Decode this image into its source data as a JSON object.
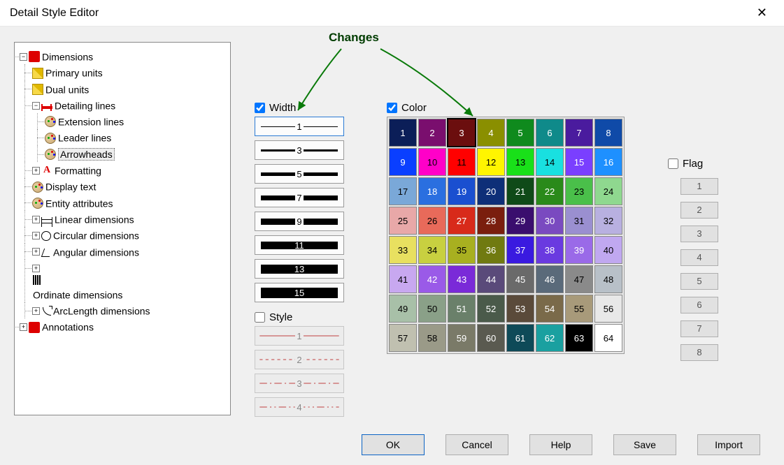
{
  "window": {
    "title": "Detail Style Editor"
  },
  "annotation": {
    "text": "Changes"
  },
  "tree": {
    "dimensions": "Dimensions",
    "primary_units": "Primary units",
    "dual_units": "Dual units",
    "detailing_lines": "Detailing lines",
    "extension_lines": "Extension lines",
    "leader_lines": "Leader lines",
    "arrowheads": "Arrowheads",
    "formatting": "Formatting",
    "display_text": "Display text",
    "entity_attributes": "Entity attributes",
    "linear_dimensions": "Linear dimensions",
    "circular_dimensions": "Circular dimensions",
    "angular_dimensions": "Angular dimensions",
    "ordinate_dimensions": "Ordinate dimensions",
    "arclength_dimensions": "ArcLength dimensions",
    "annotations": "Annotations"
  },
  "width": {
    "label": "Width",
    "checked": true,
    "selected_index": 0,
    "items": [
      {
        "value": 1,
        "thickness": 1
      },
      {
        "value": 3,
        "thickness": 3
      },
      {
        "value": 5,
        "thickness": 5
      },
      {
        "value": 7,
        "thickness": 7
      },
      {
        "value": 9,
        "thickness": 9
      },
      {
        "value": 11,
        "thickness": 11
      },
      {
        "value": 13,
        "thickness": 13
      },
      {
        "value": 15,
        "thickness": 15
      }
    ]
  },
  "style": {
    "label": "Style",
    "checked": false,
    "items": [
      {
        "value": 1,
        "dash": ""
      },
      {
        "value": 2,
        "dash": "4 4"
      },
      {
        "value": 3,
        "dash": "10 4 2 4"
      },
      {
        "value": 4,
        "dash": "10 4 2 4 2 4"
      }
    ]
  },
  "color": {
    "label": "Color",
    "checked": true,
    "selected": 3,
    "swatches": [
      {
        "n": 1,
        "bg": "#0b1e58",
        "fg": "#fff"
      },
      {
        "n": 2,
        "bg": "#7a0e6e",
        "fg": "#fff"
      },
      {
        "n": 3,
        "bg": "#6b0e0e",
        "fg": "#fff"
      },
      {
        "n": 4,
        "bg": "#8a8f00",
        "fg": "#fff"
      },
      {
        "n": 5,
        "bg": "#0f8a1d",
        "fg": "#fff"
      },
      {
        "n": 6,
        "bg": "#0f8a8a",
        "fg": "#fff"
      },
      {
        "n": 7,
        "bg": "#4a1b9e",
        "fg": "#fff"
      },
      {
        "n": 8,
        "bg": "#0f4aa8",
        "fg": "#fff"
      },
      {
        "n": 9,
        "bg": "#0a3fff",
        "fg": "#fff"
      },
      {
        "n": 10,
        "bg": "#ff00c8",
        "fg": "#000"
      },
      {
        "n": 11,
        "bg": "#ff0000",
        "fg": "#000"
      },
      {
        "n": 12,
        "bg": "#fff500",
        "fg": "#000"
      },
      {
        "n": 13,
        "bg": "#19e019",
        "fg": "#000"
      },
      {
        "n": 14,
        "bg": "#19e0e0",
        "fg": "#000"
      },
      {
        "n": 15,
        "bg": "#7a3fff",
        "fg": "#fff"
      },
      {
        "n": 16,
        "bg": "#1e90ff",
        "fg": "#fff"
      },
      {
        "n": 17,
        "bg": "#7aa8d8",
        "fg": "#000"
      },
      {
        "n": 18,
        "bg": "#2a6fe0",
        "fg": "#fff"
      },
      {
        "n": 19,
        "bg": "#1a4fd0",
        "fg": "#fff"
      },
      {
        "n": 20,
        "bg": "#0e2f78",
        "fg": "#fff"
      },
      {
        "n": 21,
        "bg": "#0f4a18",
        "fg": "#fff"
      },
      {
        "n": 22,
        "bg": "#2a8a1a",
        "fg": "#fff"
      },
      {
        "n": 23,
        "bg": "#4abf4a",
        "fg": "#000"
      },
      {
        "n": 24,
        "bg": "#8fd88f",
        "fg": "#000"
      },
      {
        "n": 25,
        "bg": "#e8a8a8",
        "fg": "#000"
      },
      {
        "n": 26,
        "bg": "#e86a5a",
        "fg": "#000"
      },
      {
        "n": 27,
        "bg": "#d82a1a",
        "fg": "#fff"
      },
      {
        "n": 28,
        "bg": "#7a1e0e",
        "fg": "#fff"
      },
      {
        "n": 29,
        "bg": "#3a0e6e",
        "fg": "#fff"
      },
      {
        "n": 30,
        "bg": "#7a4ac0",
        "fg": "#fff"
      },
      {
        "n": 31,
        "bg": "#9a8fd0",
        "fg": "#000"
      },
      {
        "n": 32,
        "bg": "#b8b0e0",
        "fg": "#000"
      },
      {
        "n": 33,
        "bg": "#e8e060",
        "fg": "#000"
      },
      {
        "n": 34,
        "bg": "#c8d040",
        "fg": "#000"
      },
      {
        "n": 35,
        "bg": "#a8b020",
        "fg": "#000"
      },
      {
        "n": 36,
        "bg": "#707a10",
        "fg": "#fff"
      },
      {
        "n": 37,
        "bg": "#3a1ae0",
        "fg": "#fff"
      },
      {
        "n": 38,
        "bg": "#6a3ae0",
        "fg": "#fff"
      },
      {
        "n": 39,
        "bg": "#9a6ae8",
        "fg": "#fff"
      },
      {
        "n": 40,
        "bg": "#c0a8f0",
        "fg": "#000"
      },
      {
        "n": 41,
        "bg": "#c8a8f0",
        "fg": "#000"
      },
      {
        "n": 42,
        "bg": "#9a5ae8",
        "fg": "#fff"
      },
      {
        "n": 43,
        "bg": "#7a2ad8",
        "fg": "#fff"
      },
      {
        "n": 44,
        "bg": "#5a4a7a",
        "fg": "#fff"
      },
      {
        "n": 45,
        "bg": "#6a6a6a",
        "fg": "#fff"
      },
      {
        "n": 46,
        "bg": "#5a6a7a",
        "fg": "#fff"
      },
      {
        "n": 47,
        "bg": "#8a8a8a",
        "fg": "#000"
      },
      {
        "n": 48,
        "bg": "#b8c0c8",
        "fg": "#000"
      },
      {
        "n": 49,
        "bg": "#a8c0a8",
        "fg": "#000"
      },
      {
        "n": 50,
        "bg": "#8aa088",
        "fg": "#000"
      },
      {
        "n": 51,
        "bg": "#6a806a",
        "fg": "#fff"
      },
      {
        "n": 52,
        "bg": "#4a5a4a",
        "fg": "#fff"
      },
      {
        "n": 53,
        "bg": "#5a4a3a",
        "fg": "#fff"
      },
      {
        "n": 54,
        "bg": "#7a6a4a",
        "fg": "#fff"
      },
      {
        "n": 55,
        "bg": "#a89a7a",
        "fg": "#000"
      },
      {
        "n": 56,
        "bg": "#e8e8e8",
        "fg": "#000"
      },
      {
        "n": 57,
        "bg": "#c0c0b0",
        "fg": "#000"
      },
      {
        "n": 58,
        "bg": "#9a9a88",
        "fg": "#000"
      },
      {
        "n": 59,
        "bg": "#7a7a68",
        "fg": "#fff"
      },
      {
        "n": 60,
        "bg": "#5a5a50",
        "fg": "#fff"
      },
      {
        "n": 61,
        "bg": "#0e4a58",
        "fg": "#fff"
      },
      {
        "n": 62,
        "bg": "#1aa0a0",
        "fg": "#fff"
      },
      {
        "n": 63,
        "bg": "#000000",
        "fg": "#fff"
      },
      {
        "n": 64,
        "bg": "#ffffff",
        "fg": "#000"
      }
    ]
  },
  "flag": {
    "label": "Flag",
    "checked": false,
    "items": [
      1,
      2,
      3,
      4,
      5,
      6,
      7,
      8
    ]
  },
  "buttons": {
    "ok": "OK",
    "cancel": "Cancel",
    "help": "Help",
    "save": "Save",
    "import": "Import"
  }
}
